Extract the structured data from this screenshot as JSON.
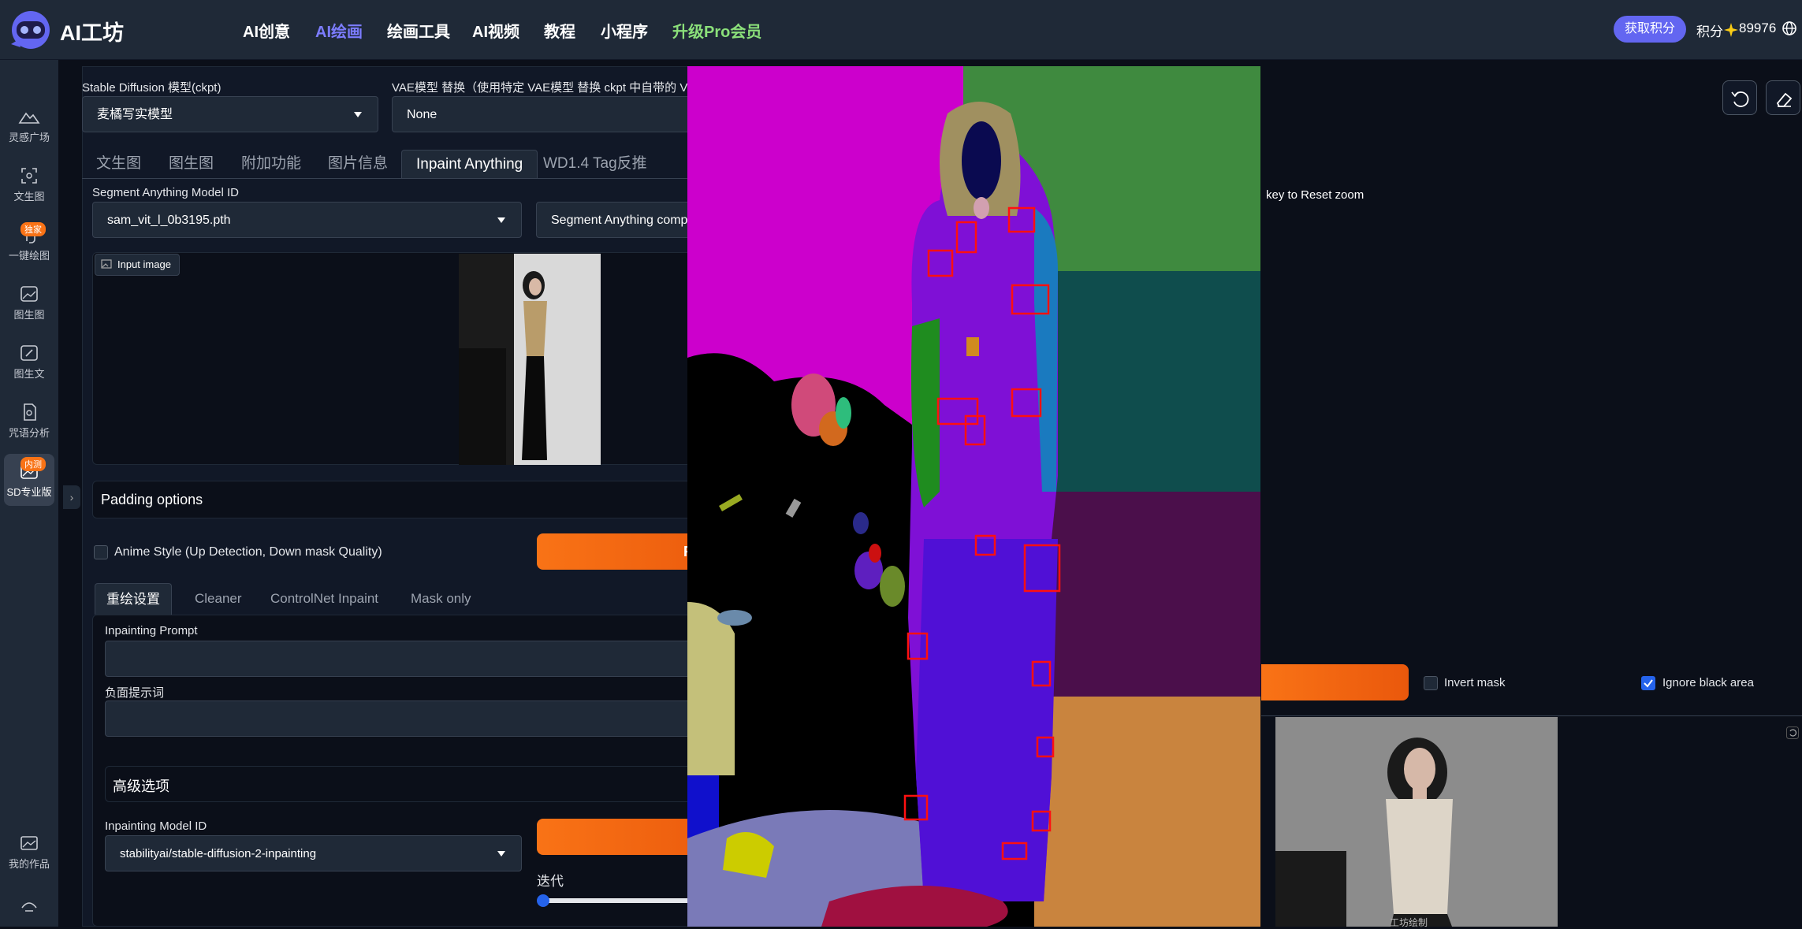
{
  "app": {
    "logo_text": "AI工坊",
    "nav": [
      "AI创意",
      "AI绘画",
      "绘画工具",
      "AI视频",
      "教程",
      "小程序",
      "升级Pro会员"
    ],
    "get_points_label": "获取积分",
    "points_label": "积分",
    "points_value": "89976"
  },
  "sidebar": {
    "items": [
      {
        "label": "灵感广场",
        "icon": "mountain-icon"
      },
      {
        "label": "文生图",
        "icon": "scan-icon"
      },
      {
        "label": "一键绘图",
        "icon": "hand-icon",
        "badge": "独家"
      },
      {
        "label": "图生图",
        "icon": "image-icon"
      },
      {
        "label": "图生文",
        "icon": "image-edit-icon"
      },
      {
        "label": "咒语分析",
        "icon": "doc-search-icon"
      },
      {
        "label": "SD专业版",
        "icon": "sd-icon",
        "badge": "内测"
      }
    ],
    "my_works_label": "我的作品"
  },
  "settings": {
    "ckpt_label": "Stable Diffusion 模型(ckpt)",
    "ckpt_value": "麦橘写实模型",
    "vae_label": "VAE模型 替换（使用特定 VAE模型 替换 ckpt 中自带的 V",
    "vae_value": "None"
  },
  "tabs": [
    "文生图",
    "图生图",
    "附加功能",
    "图片信息",
    "Inpaint Anything",
    "WD1.4 Tag反推"
  ],
  "inpaint": {
    "sam_label": "Segment Anything Model ID",
    "sam_value": "sam_vit_l_0b3195.pth",
    "sam_status": "Segment Anything complet",
    "input_image_label": "Input image",
    "padding_label": "Padding options",
    "anime_label": "Anime Style (Up Detection, Down mask Quality)",
    "run_partial": "R",
    "subtabs": [
      "重绘设置",
      "Cleaner",
      "ControlNet Inpaint",
      "Mask only"
    ],
    "prompt_label": "Inpainting Prompt",
    "neg_label": "负面提示词",
    "advanced_label": "高级选项",
    "model_label": "Inpainting Model ID",
    "model_value": "stabilityai/stable-diffusion-2-inpainting",
    "steps_label": "迭代"
  },
  "right": {
    "zoom_hint": "key to Reset zoom",
    "invert_label": "Invert mask",
    "ignore_label": "Ignore black area",
    "watermark": "工坊绘制"
  },
  "colors": {
    "accent": "#6366f1",
    "pro": "#8be07a",
    "orange": "#f97316",
    "checked": "#2563eb"
  }
}
